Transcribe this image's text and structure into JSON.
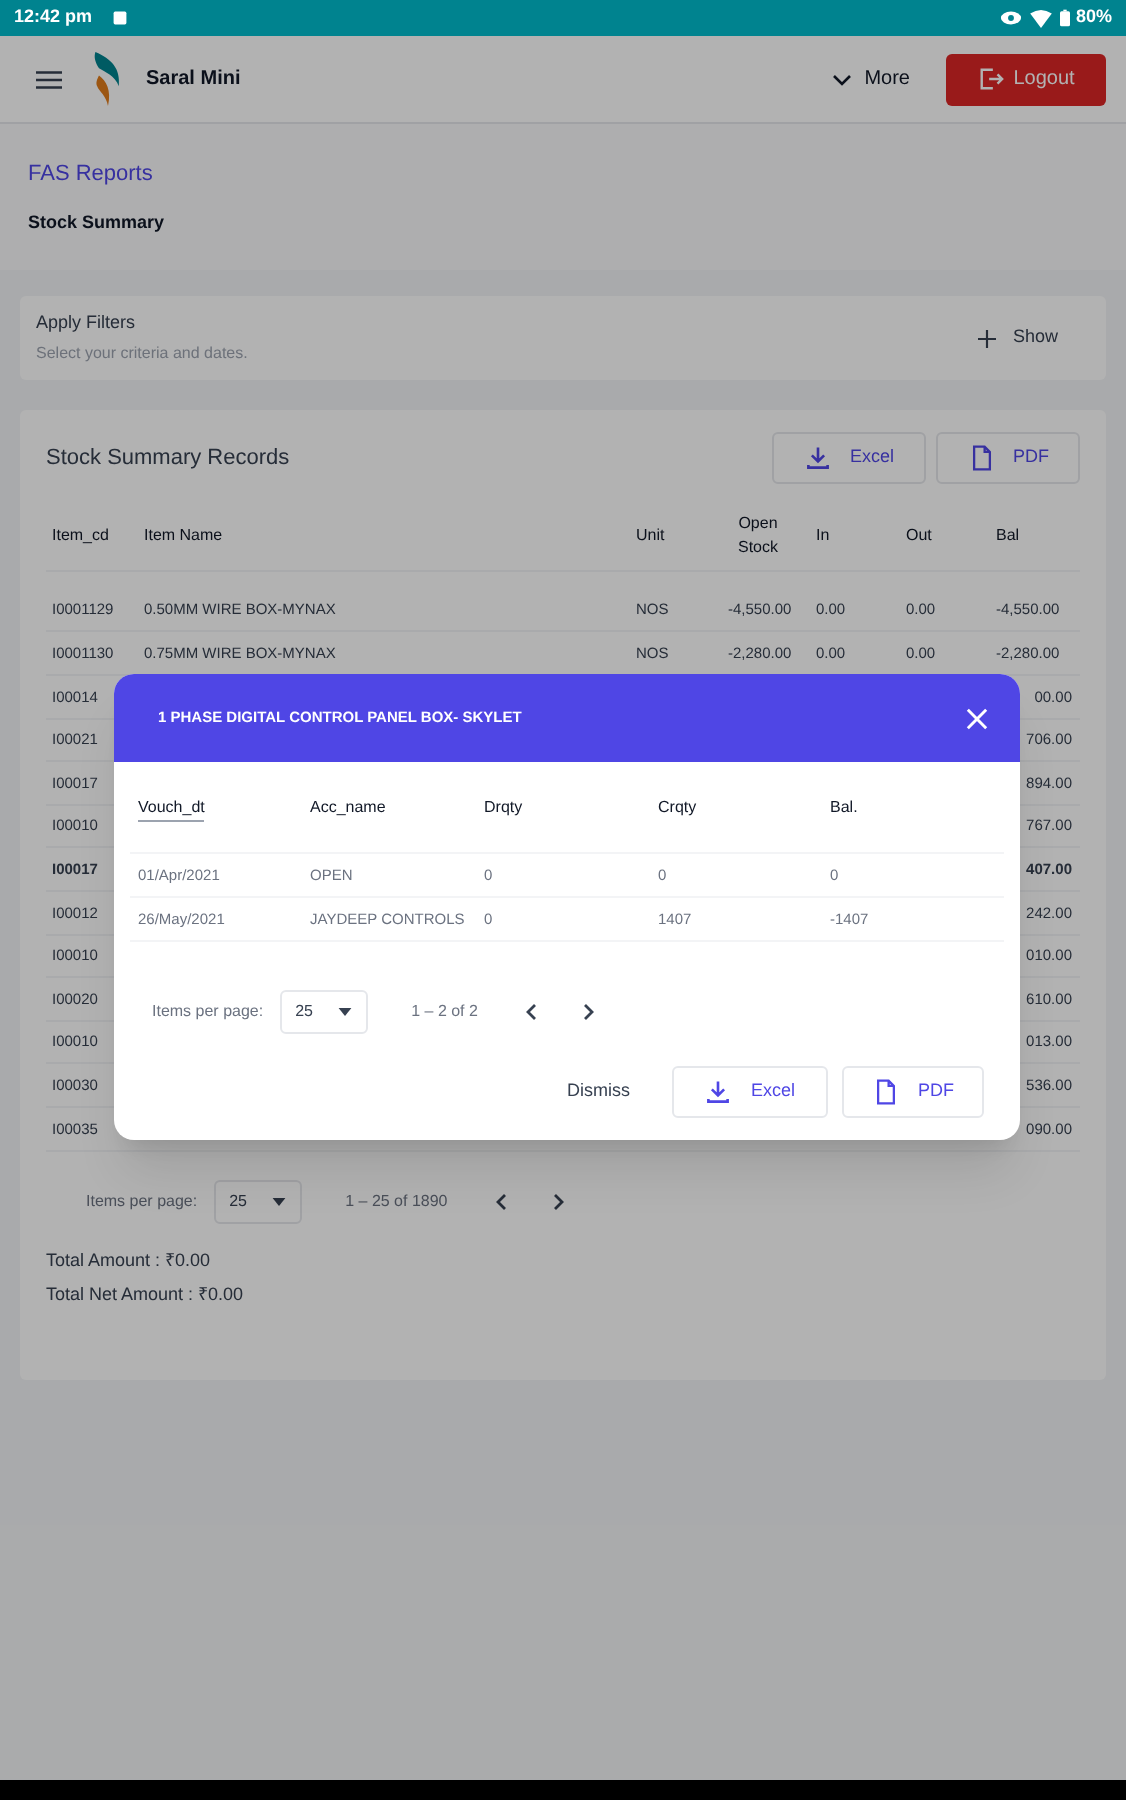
{
  "status_bar": {
    "time": "12:42 pm",
    "battery": "80%"
  },
  "header": {
    "app_name": "Saral Mini",
    "more": "More",
    "logout": "Logout"
  },
  "breadcrumb": {
    "section": "FAS Reports",
    "page": "Stock Summary"
  },
  "filters": {
    "title": "Apply Filters",
    "subtitle": "Select your criteria and dates.",
    "toggle": "Show"
  },
  "records": {
    "title": "Stock Summary Records",
    "excel": "Excel",
    "pdf": "PDF",
    "columns": [
      "Item_cd",
      "Item Name",
      "Unit",
      "Open Stock",
      "In",
      "Out",
      "Bal"
    ],
    "rows": [
      {
        "kind": "full",
        "selected": false,
        "cells": [
          "I0001129",
          "0.50MM WIRE BOX-MYNAX",
          "NOS",
          "-4,550.00",
          "0.00",
          "0.00",
          "-4,550.00"
        ]
      },
      {
        "kind": "full",
        "selected": false,
        "cells": [
          "I0001130",
          "0.75MM WIRE BOX-MYNAX",
          "NOS",
          "-2,280.00",
          "0.00",
          "0.00",
          "-2,280.00"
        ]
      },
      {
        "kind": "partial",
        "selected": false,
        "cells": [
          "I00014",
          "00.00"
        ]
      },
      {
        "kind": "partial",
        "selected": false,
        "cells": [
          "I00021",
          "706.00"
        ]
      },
      {
        "kind": "partial",
        "selected": false,
        "cells": [
          "I00017",
          "894.00"
        ]
      },
      {
        "kind": "partial",
        "selected": false,
        "cells": [
          "I00010",
          "767.00"
        ]
      },
      {
        "kind": "partial",
        "selected": true,
        "cells": [
          "I00017",
          "407.00"
        ]
      },
      {
        "kind": "partial",
        "selected": false,
        "cells": [
          "I00012",
          "242.00"
        ]
      },
      {
        "kind": "partial",
        "selected": false,
        "cells": [
          "I00010",
          "010.00"
        ]
      },
      {
        "kind": "partial",
        "selected": false,
        "cells": [
          "I00020",
          "610.00"
        ]
      },
      {
        "kind": "partial",
        "selected": false,
        "cells": [
          "I00010",
          "013.00"
        ]
      },
      {
        "kind": "partial",
        "selected": false,
        "cells": [
          "I00030",
          "536.00"
        ]
      },
      {
        "kind": "partial",
        "selected": false,
        "cells": [
          "I00035",
          "090.00"
        ]
      }
    ],
    "paginator": {
      "label": "Items per page:",
      "page_size": "25",
      "range": "1 – 25 of 1890"
    },
    "totals": [
      "Total Amount : ₹0.00",
      "Total Net Amount : ₹0.00"
    ]
  },
  "dialog": {
    "title": "1 PHASE DIGITAL CONTROL PANEL BOX- SKYLET",
    "columns": [
      {
        "label": "Vouch_dt",
        "sorted": true
      },
      {
        "label": "Acc_name",
        "sorted": false
      },
      {
        "label": "Drqty",
        "sorted": false
      },
      {
        "label": "Crqty",
        "sorted": false
      },
      {
        "label": "Bal.",
        "sorted": false
      }
    ],
    "rows": [
      [
        "01/Apr/2021",
        "OPEN",
        "0",
        "0",
        "0"
      ],
      [
        "26/May/2021",
        "JAYDEEP CONTROLS",
        "0",
        "1407",
        "-1407"
      ]
    ],
    "paginator": {
      "label": "Items per page:",
      "page_size": "25",
      "range": "1 – 2 of 2"
    },
    "dismiss": "Dismiss",
    "excel": "Excel",
    "pdf": "PDF"
  }
}
